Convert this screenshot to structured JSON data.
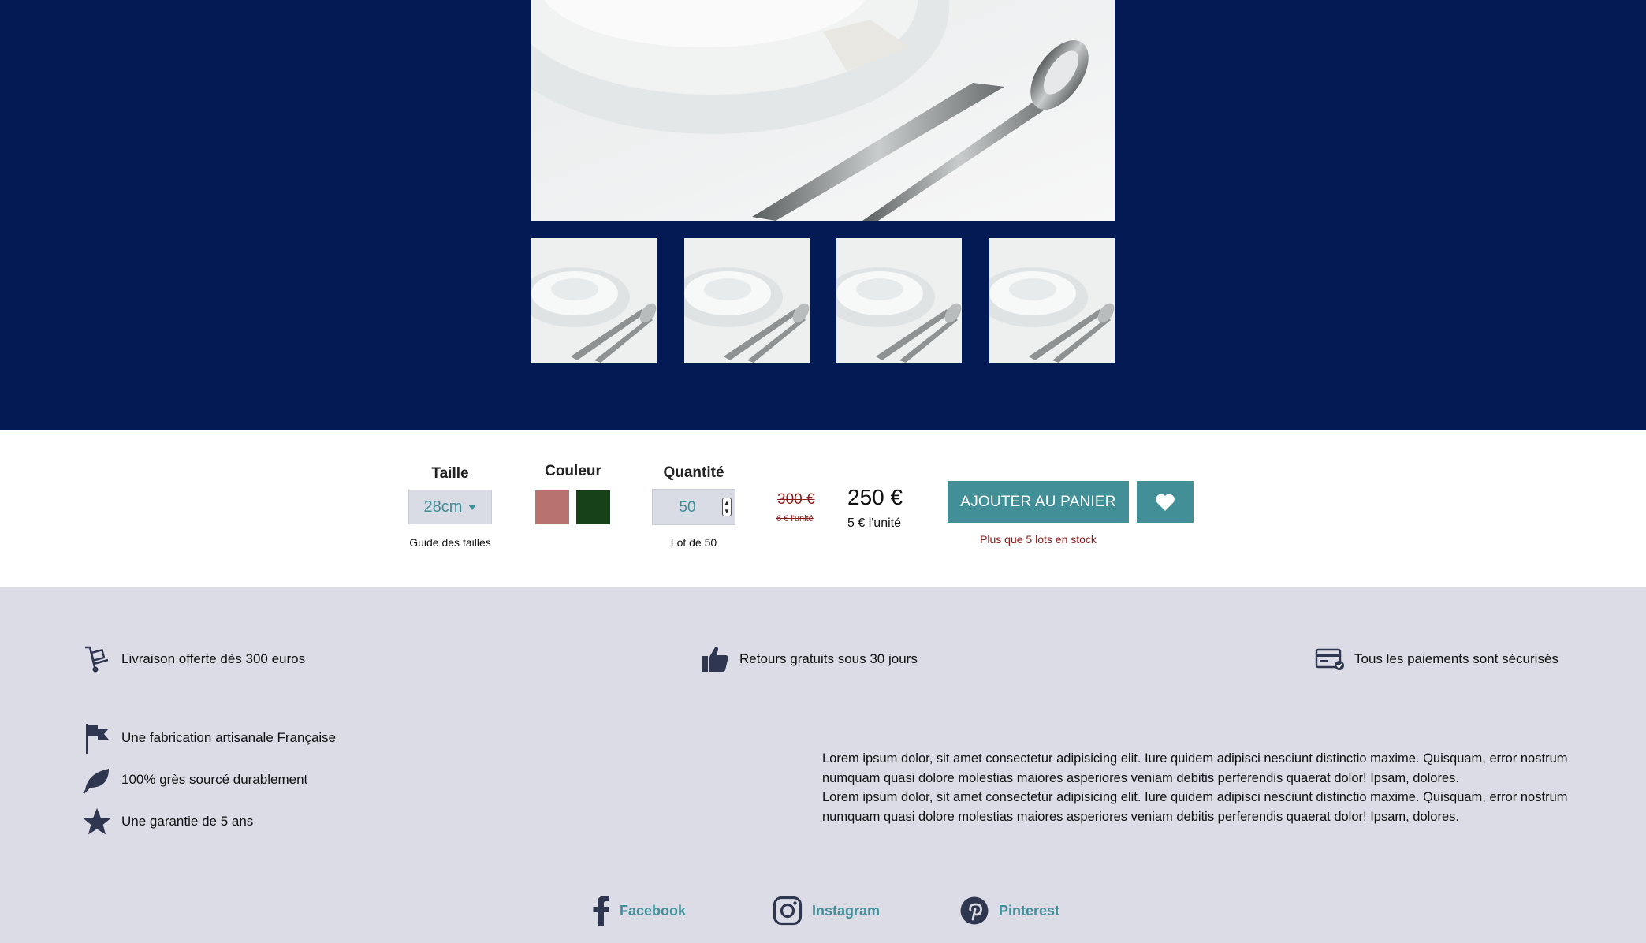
{
  "product": {
    "size": {
      "label": "Taille",
      "value": "28cm",
      "guide": "Guide des tailles"
    },
    "color": {
      "label": "Couleur",
      "swatches": [
        "#b8736e",
        "#174217"
      ]
    },
    "quantity": {
      "label": "Quantité",
      "value": "50",
      "lot": "Lot de 50"
    },
    "price": {
      "old": "300 €",
      "old_unit": "6 € l'unité",
      "new": "250 €",
      "new_unit": "5 € l'unité"
    },
    "cart_label": "AJOUTER AU PANIER",
    "stock": "Plus que 5 lots en stock"
  },
  "perks": {
    "delivery": "Livraison offerte dès 300 euros",
    "returns": "Retours gratuits sous 30 jours",
    "payment": "Tous les paiements sont sécurisés"
  },
  "features": {
    "craft": "Une fabrication artisanale Française",
    "material": "100% grès sourcé durablement",
    "warranty": "Une garantie de 5 ans"
  },
  "description": {
    "line1": "Lorem ipsum dolor, sit amet consectetur adipisicing elit. Iure quidem adipisci nesciunt distinctio maxime. Quisquam, error nostrum numquam quasi dolore molestias maiores asperiores veniam debitis perferendis quaerat dolor! Ipsam, dolores.",
    "line2": "Lorem ipsum dolor, sit amet consectetur adipisicing elit. Iure quidem adipisci nesciunt distinctio maxime. Quisquam, error nostrum numquam quasi dolore molestias maiores asperiores veniam debitis perferendis quaerat dolor! Ipsam, dolores."
  },
  "social": {
    "facebook": "Facebook",
    "instagram": "Instagram",
    "pinterest": "Pinterest"
  },
  "colors": {
    "hero_bg": "#031a55",
    "accent": "#438f98",
    "footer_bg": "#dcdce6",
    "price_strike": "#8b1a1a"
  },
  "icons": [
    "cart-icon",
    "thumbs-up-icon",
    "credit-card-icon",
    "flag-icon",
    "leaf-icon",
    "star-icon",
    "heart-icon",
    "facebook-icon",
    "instagram-icon",
    "pinterest-icon"
  ]
}
